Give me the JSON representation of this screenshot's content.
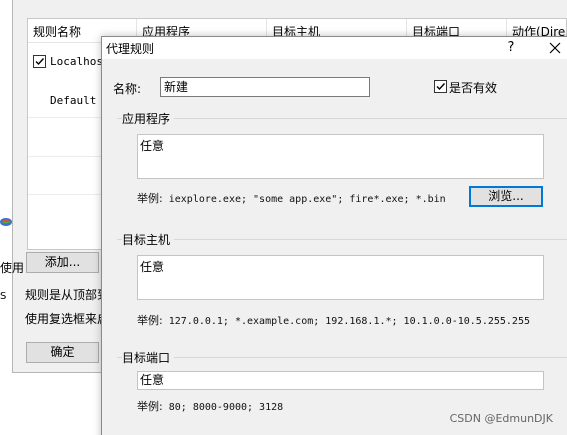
{
  "background_window": {
    "columns": [
      "规则名称",
      "应用程序",
      "目标主机",
      "目标端口",
      "动作(Dire"
    ],
    "rules": [
      {
        "name": "Localhost",
        "checked": true
      },
      {
        "name": "Default",
        "checked": false
      }
    ],
    "add_button": "添加...",
    "partial_text_1": "使用",
    "partial_text_2": "S",
    "hint_1": "规则是从顶部到",
    "hint_2": "使用复选框来启",
    "ok_button": "确定"
  },
  "dialog": {
    "title": "代理规则",
    "help_glyph": "?",
    "name_label": "名称:",
    "name_value": "新建",
    "enabled_label": "是否有效",
    "enabled_checked": true,
    "applications": {
      "group_label": "应用程序",
      "value": "任意",
      "example_prefix": "举例:",
      "example_text": "iexplore.exe; \"some app.exe\"; fire*.exe; *.bin",
      "browse_button": "浏览..."
    },
    "target_hosts": {
      "group_label": "目标主机",
      "value": "任意",
      "example_prefix": "举例:",
      "example_text": "127.0.0.1; *.example.com; 192.168.1.*; 10.1.0.0-10.5.255.255"
    },
    "target_ports": {
      "group_label": "目标端口",
      "value": "任意",
      "example_prefix": "举例:",
      "example_text": "80; 8000-9000; 3128"
    }
  },
  "watermark": "CSDN @EdmunDJK",
  "colors": {
    "dialog_bg": "#f0f0f0",
    "focus_border": "#0078d7",
    "button_bg": "#e1e1e1"
  }
}
